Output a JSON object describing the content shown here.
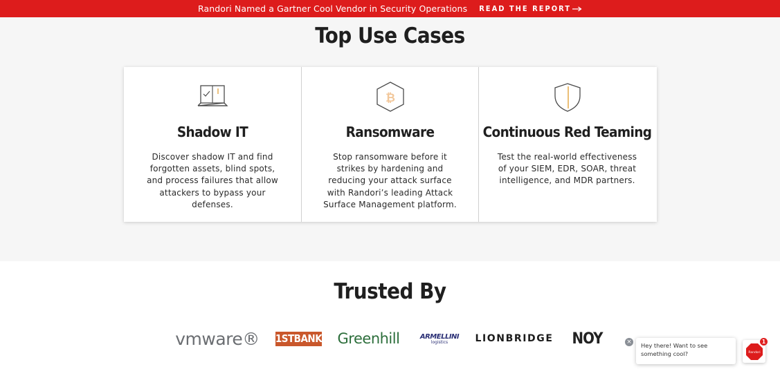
{
  "banner": {
    "message": "Randori Named a Gartner Cool Vendor in Security Operations",
    "cta_label": "READ THE REPORT",
    "color": "#dd1c1c"
  },
  "use_cases": {
    "title": "Top Use Cases",
    "cards": [
      {
        "icon": "laptop-checklist-icon",
        "title": "Shadow IT",
        "description": "Discover shadow IT and find forgotten assets, blind spots, and process failures that allow attackers to bypass your defenses."
      },
      {
        "icon": "bitcoin-hexagon-icon",
        "title": "Ransomware",
        "description": "Stop ransomware before it strikes by hardening and reducing your attack surface with Randori’s leading Attack Surface Management platform."
      },
      {
        "icon": "shield-icon",
        "title": "Continuous Red Teaming",
        "description": "Test the real-world effectiveness of your SIEM, EDR, SOAR, threat intelligence, and MDR partners."
      }
    ]
  },
  "trusted": {
    "title": "Trusted By",
    "logos": {
      "vmware": "vmware®",
      "firstbank": "1STBANK",
      "greenhill": "Greenhill",
      "armellini_1": "ARMELLINI",
      "armellini_2": "logistics",
      "lionbridge": "LIONBRIDGE",
      "noy": "NOY"
    }
  },
  "chat": {
    "message": "Hey there! Want to see something cool?",
    "close_label": "×",
    "badge_count": "1",
    "avatar_label": "Randori"
  }
}
